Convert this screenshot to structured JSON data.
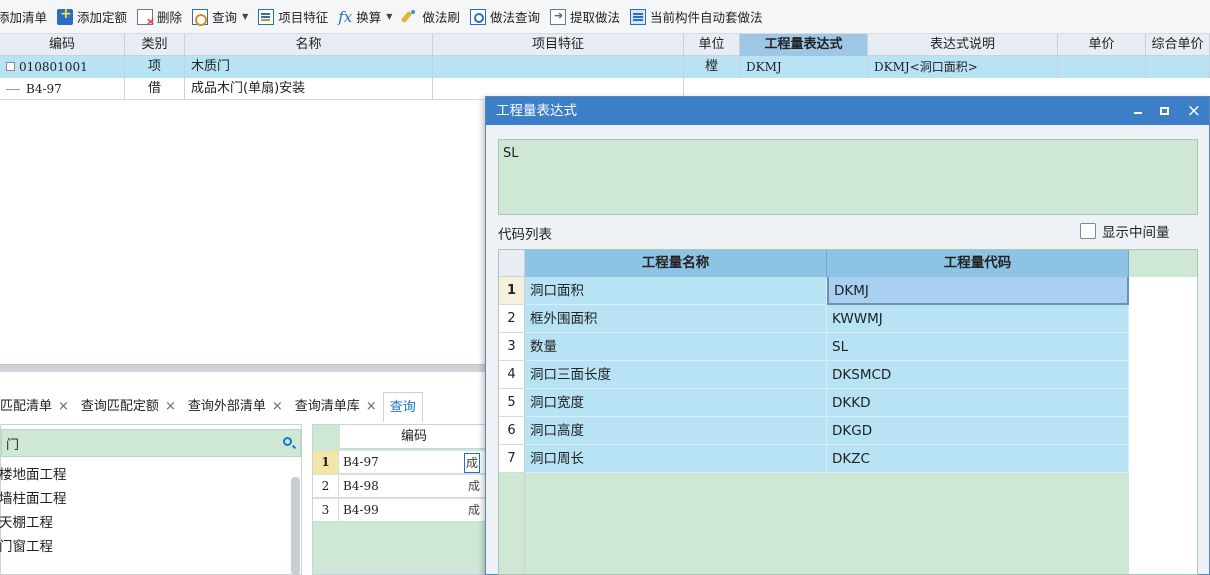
{
  "toolbar": {
    "items": [
      {
        "label": "添加清单",
        "icon": "add-list-icon"
      },
      {
        "label": "添加定额",
        "icon": "add-quota-icon"
      },
      {
        "label": "删除",
        "icon": "delete-icon"
      },
      {
        "label": "查询",
        "icon": "query-icon",
        "dropdown": true
      },
      {
        "label": "项目特征",
        "icon": "feature-icon"
      },
      {
        "label": "换算",
        "icon": "fx-icon",
        "dropdown": true
      },
      {
        "label": "做法刷",
        "icon": "brush-icon"
      },
      {
        "label": "做法查询",
        "icon": "method-query-icon"
      },
      {
        "label": "提取做法",
        "icon": "extract-icon"
      },
      {
        "label": "当前构件自动套做法",
        "icon": "auto-apply-icon"
      }
    ]
  },
  "grid": {
    "columns": [
      "编码",
      "类别",
      "名称",
      "项目特征",
      "单位",
      "工程量表达式",
      "表达式说明",
      "单价",
      "综合单价"
    ],
    "rows": [
      {
        "code": "010801001",
        "type": "项",
        "name": "木质门",
        "feature": "",
        "unit": "樘",
        "expr": "DKMJ",
        "expr_desc": "DKMJ<洞口面积>",
        "price": "",
        "total": ""
      },
      {
        "code": "B4-97",
        "type": "借",
        "name": "成品木门(单扇)安装",
        "feature": "",
        "unit": "",
        "expr": "",
        "expr_desc": "",
        "price": "",
        "total": ""
      }
    ]
  },
  "bottom_tabs": [
    {
      "label": "匹配清单"
    },
    {
      "label": "查询匹配定额"
    },
    {
      "label": "查询外部清单"
    },
    {
      "label": "查询清单库"
    },
    {
      "label": "查询"
    }
  ],
  "left_pane": {
    "search_value": "门",
    "tree": [
      "楼地面工程",
      "墙柱面工程",
      "天棚工程",
      "门窗工程"
    ]
  },
  "mid_pane": {
    "header": "编码",
    "rows": [
      {
        "num": "1",
        "code": "B4-97",
        "tail": "成"
      },
      {
        "num": "2",
        "code": "B4-98",
        "tail": "成"
      },
      {
        "num": "3",
        "code": "B4-99",
        "tail": "成"
      }
    ]
  },
  "dialog": {
    "title": "工程量表达式",
    "expression": "SL",
    "code_list_label": "代码列表",
    "show_intermediate": "显示中间量",
    "columns": [
      "工程量名称",
      "工程量代码"
    ],
    "rows": [
      {
        "num": "1",
        "name": "洞口面积",
        "code": "DKMJ"
      },
      {
        "num": "2",
        "name": "框外围面积",
        "code": "KWWMJ"
      },
      {
        "num": "3",
        "name": "数量",
        "code": "SL"
      },
      {
        "num": "4",
        "name": "洞口三面长度",
        "code": "DKSMCD"
      },
      {
        "num": "5",
        "name": "洞口宽度",
        "code": "DKKD"
      },
      {
        "num": "6",
        "name": "洞口高度",
        "code": "DKGD"
      },
      {
        "num": "7",
        "name": "洞口周长",
        "code": "DKZC"
      }
    ]
  },
  "colors": {
    "row_highlight": "#b7e3f5",
    "expr_box": "#cfe8d6",
    "dialog_title": "#3d7ec9",
    "header_highlight": "#9ec7e6"
  }
}
